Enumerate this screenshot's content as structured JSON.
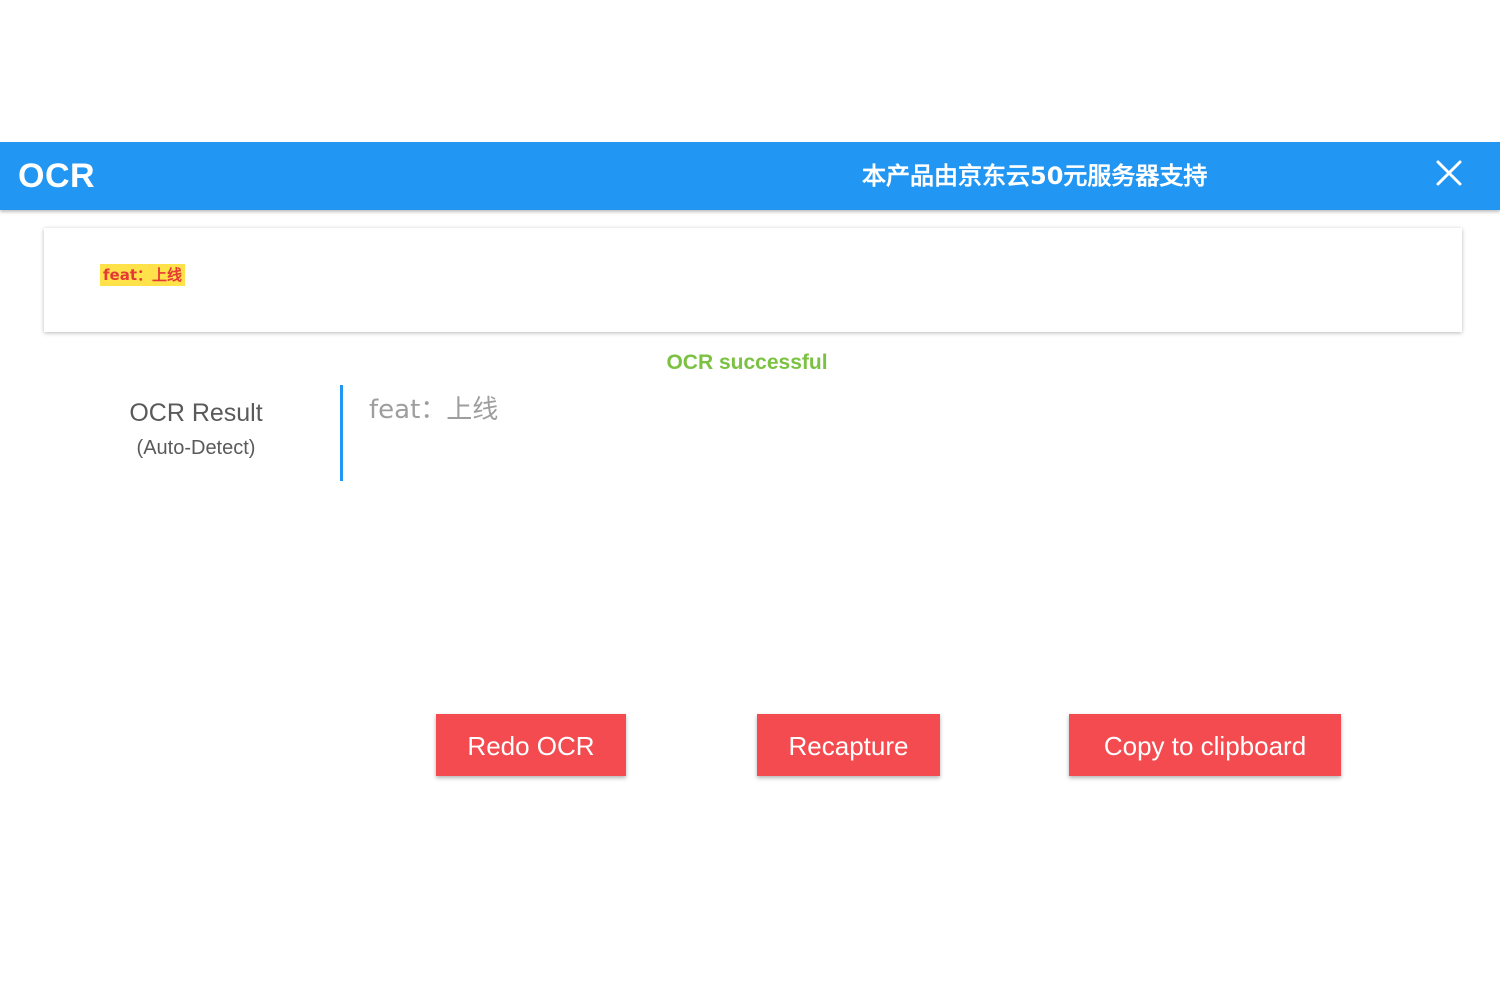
{
  "window": {
    "title": "OCR",
    "sponsor": "本产品由京东云50元服务器支持",
    "close_icon": "close-icon"
  },
  "preview": {
    "snippet_text": "feat：上线"
  },
  "status": {
    "text": "OCR successful",
    "color": "#7cc242"
  },
  "result": {
    "label": "OCR Result",
    "sublabel": "(Auto-Detect)",
    "text": "feat：上线"
  },
  "actions": {
    "redo_label": "Redo OCR",
    "recapture_label": "Recapture",
    "copy_label": "Copy to clipboard"
  },
  "colors": {
    "titlebar": "#2196f3",
    "button": "#f44b50",
    "accent_border": "#2196f3"
  }
}
